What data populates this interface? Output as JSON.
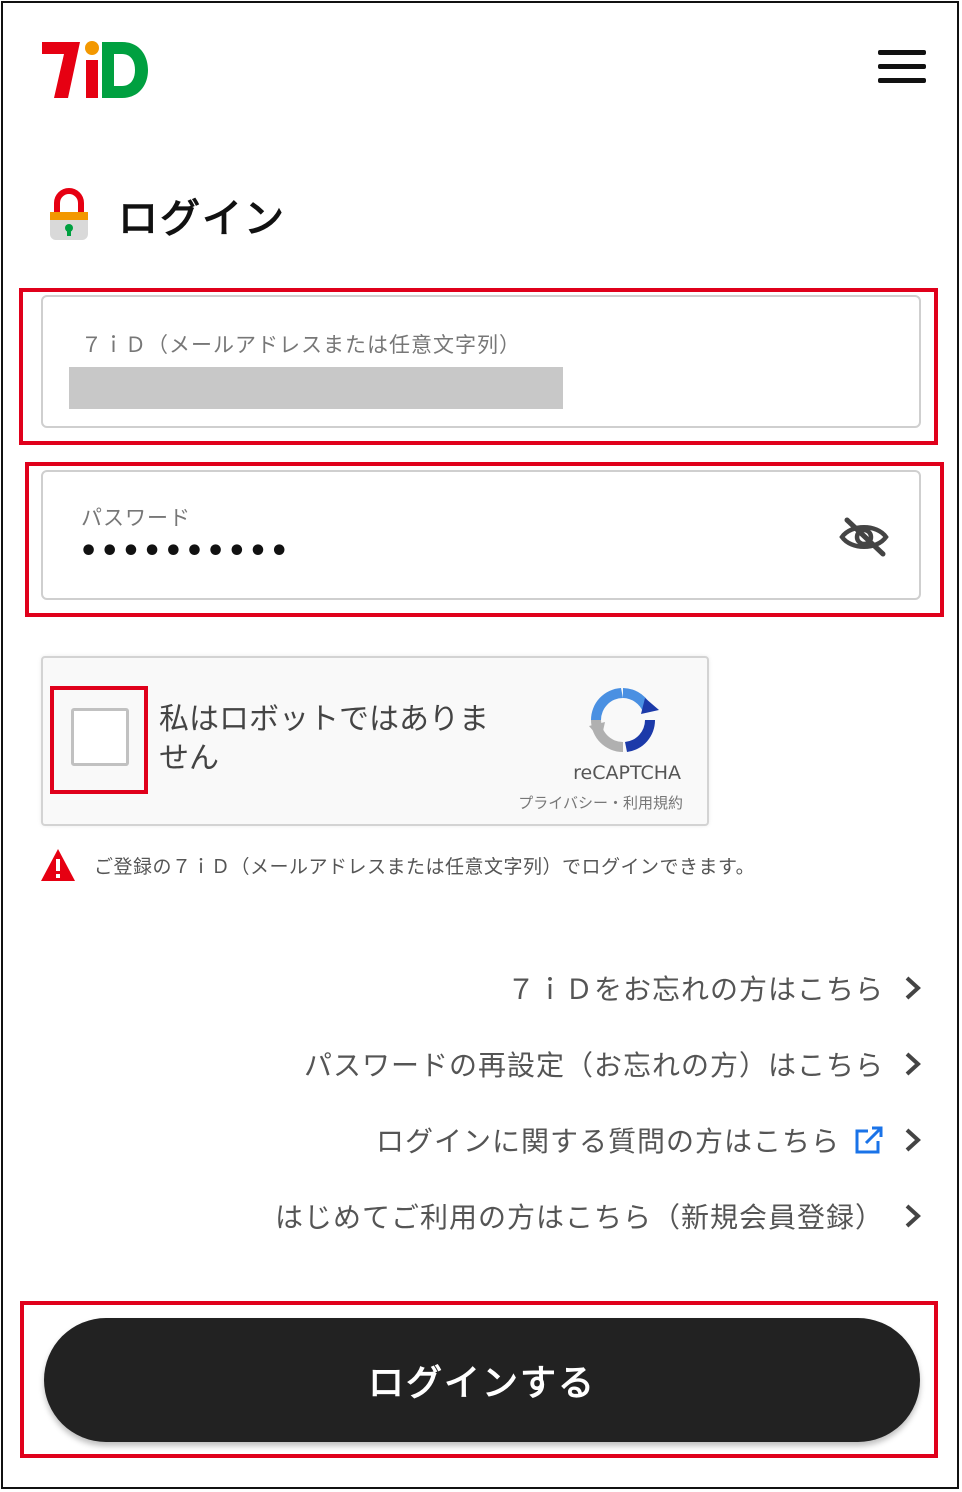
{
  "header": {
    "logo_alt": "7iD",
    "logo_icon": "7id-logo",
    "menu_icon": "hamburger-menu-icon"
  },
  "page": {
    "title": "ログイン",
    "title_icon": "lock-icon"
  },
  "form": {
    "id_field": {
      "label": "７ｉＤ（メールアドレスまたは任意文字列）",
      "value": ""
    },
    "password_field": {
      "label": "パスワード",
      "value": "••••••••••",
      "toggle_icon": "eye-slash-icon"
    }
  },
  "captcha": {
    "text": "私はロボットではありません",
    "brand": "reCAPTCHA",
    "links": "プライバシー・利用規約"
  },
  "notice": {
    "icon": "warning-triangle-icon",
    "text": "ご登録の７ｉＤ（メールアドレスまたは任意文字列）でログインできます。"
  },
  "links": [
    {
      "label": "７ｉＤをお忘れの方はこちら",
      "external": false
    },
    {
      "label": "パスワードの再設定（お忘れの方）はこちら",
      "external": false
    },
    {
      "label": "ログインに関する質問の方はこちら",
      "external": true
    },
    {
      "label": "はじめてご利用の方はこちら（新規会員登録）",
      "external": false
    }
  ],
  "submit": {
    "label": "ログインする"
  },
  "colors": {
    "highlight": "#e0001b",
    "brand_red": "#e60012",
    "brand_green": "#00a040",
    "link_blue": "#1a73e8"
  }
}
